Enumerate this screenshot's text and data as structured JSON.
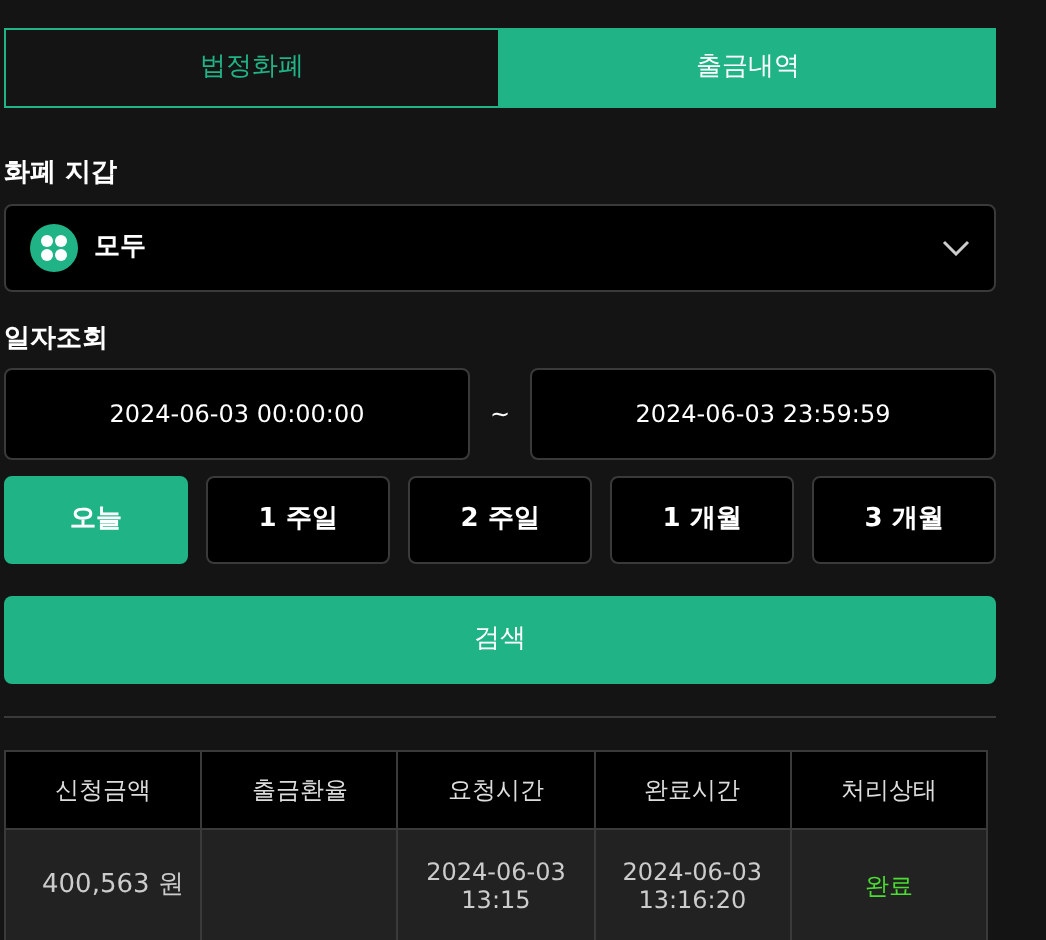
{
  "tabs": [
    {
      "label": "법정화폐",
      "selected": false
    },
    {
      "label": "출금내역",
      "selected": true
    }
  ],
  "wallet": {
    "label": "화폐 지갑",
    "value": "모두"
  },
  "date_query": {
    "label": "일자조회",
    "from": "2024-06-03 00:00:00",
    "separator": "~",
    "to": "2024-06-03 23:59:59"
  },
  "periods": [
    {
      "label": "오늘",
      "selected": true
    },
    {
      "label": "1 주일",
      "selected": false
    },
    {
      "label": "2 주일",
      "selected": false
    },
    {
      "label": "1 개월",
      "selected": false
    },
    {
      "label": "3 개월",
      "selected": false
    }
  ],
  "search_button": "검색",
  "table": {
    "columns": [
      "신청금액",
      "출금환율",
      "요청시간",
      "완료시간",
      "처리상태"
    ],
    "rows": [
      {
        "amount": "400,563 원",
        "requested": [
          "2024-06-03",
          "13:15"
        ],
        "completed": [
          "2024-06-03",
          "13:16:20"
        ],
        "status": "완료",
        "color": "#4ade30"
      }
    ]
  }
}
